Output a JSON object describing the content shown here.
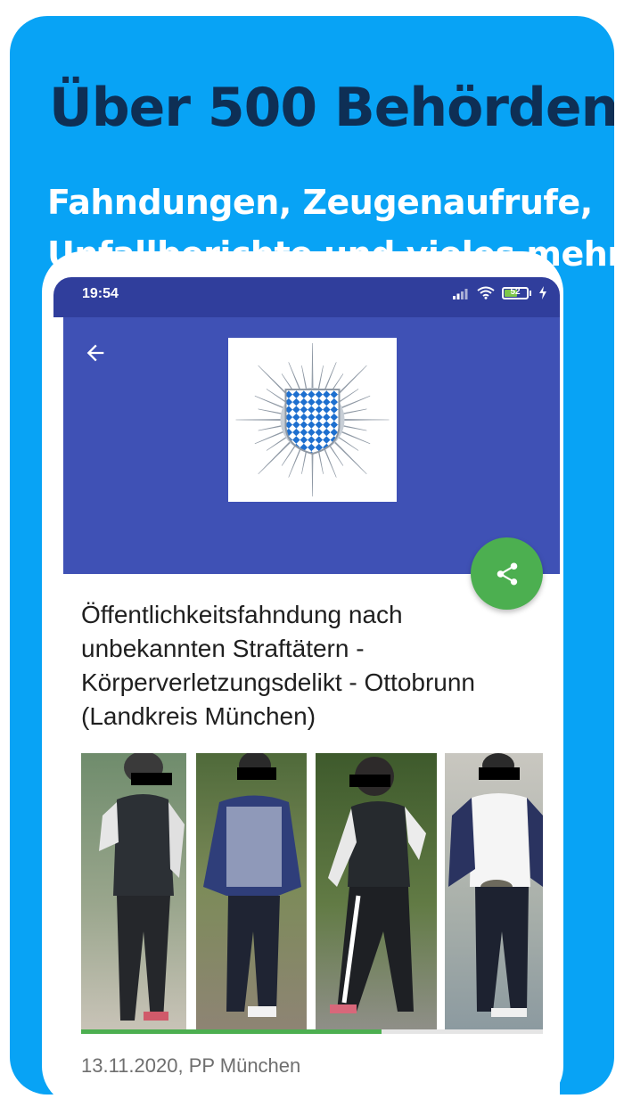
{
  "promo": {
    "headline": "Über 500 Behörden",
    "subline_1": "Fahndungen, Zeugenaufrufe,",
    "subline_2": "Unfallberichte und vieles mehr"
  },
  "status_bar": {
    "time": "19:54",
    "battery": "52",
    "icons": [
      "signal-icon",
      "wifi-icon",
      "battery-icon",
      "charging-icon"
    ]
  },
  "app_bar": {
    "back_icon": "arrow-back-icon",
    "logo": "polizei-bayern-star-logo",
    "share_icon": "share-icon"
  },
  "article": {
    "title": "Öffentlichkeitsfahndung nach unbekannten Straftätern - Körperverletzungsdelikt - Ottobrunn (Landkreis München)",
    "meta": "13.11.2020, PP München",
    "gallery_progress": 0.65
  },
  "colors": {
    "promo_background": "#08a3f5",
    "headline": "#0e2f55",
    "status_bar": "#303e9c",
    "app_bar": "#3f51b5",
    "fab": "#4caf50",
    "progress": "#4caf50"
  }
}
